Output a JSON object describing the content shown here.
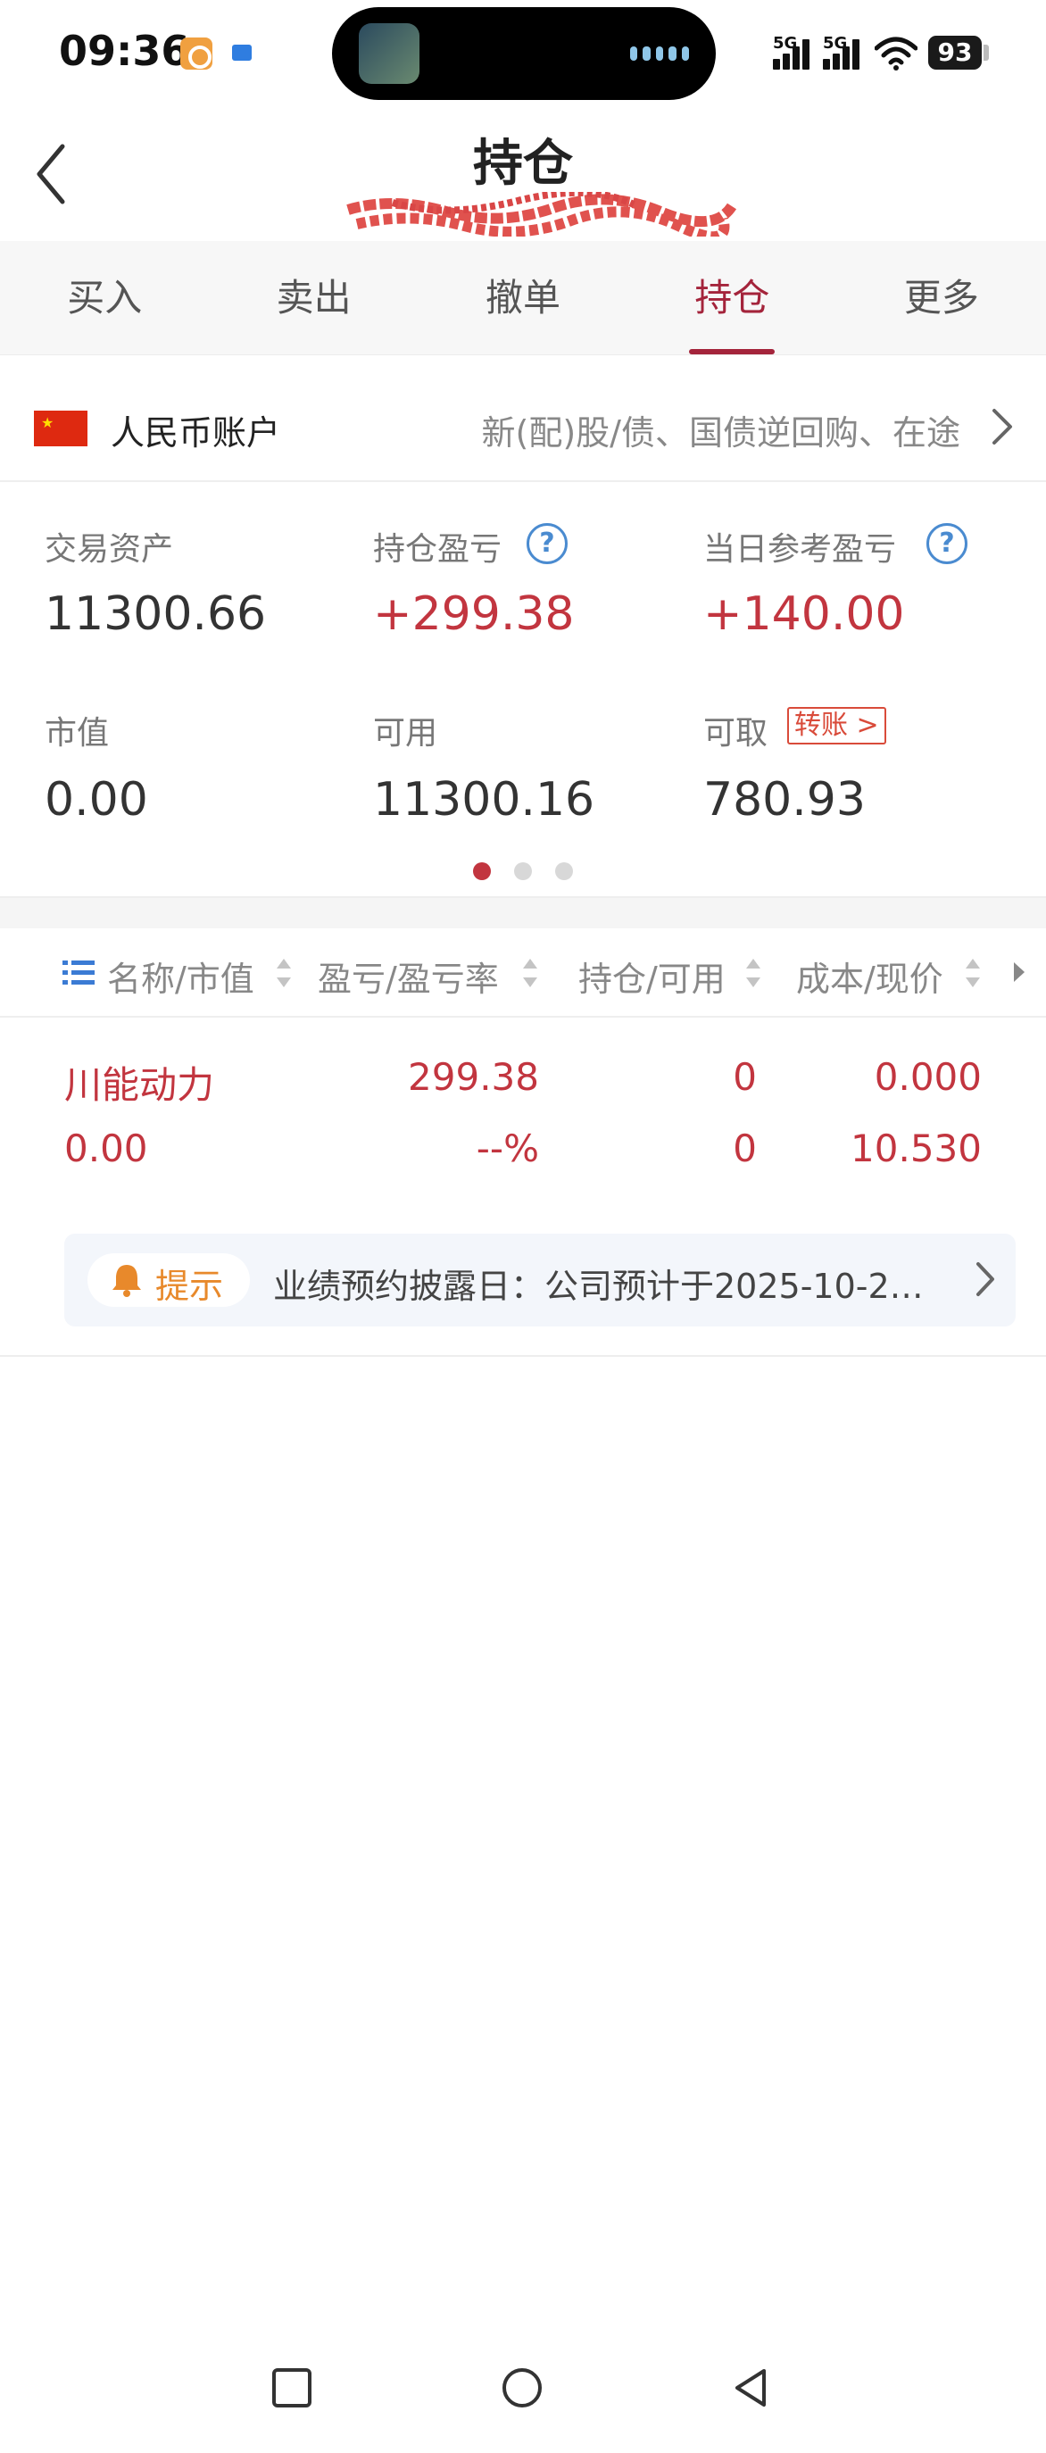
{
  "status_bar": {
    "time": "09:36",
    "network_1": "5G",
    "network_2": "5G",
    "battery": "93"
  },
  "header": {
    "title": "持仓"
  },
  "tabs": [
    {
      "label": "买入"
    },
    {
      "label": "卖出"
    },
    {
      "label": "撤单"
    },
    {
      "label": "持仓",
      "active": true
    },
    {
      "label": "更多"
    }
  ],
  "account": {
    "name": "人民币账户",
    "description": "新(配)股/债、国债逆回购、在途"
  },
  "stats": {
    "total_assets": {
      "label": "交易资产",
      "value": "11300.66"
    },
    "position_pnl": {
      "label": "持仓盈亏",
      "value": "+299.38"
    },
    "daily_pnl": {
      "label": "当日参考盈亏",
      "value": "+140.00"
    },
    "market_value": {
      "label": "市值",
      "value": "0.00"
    },
    "available": {
      "label": "可用",
      "value": "11300.16"
    },
    "withdrawable": {
      "label": "可取",
      "value": "780.93",
      "link": "转账 >"
    }
  },
  "pager": {
    "count": 3,
    "active": 0
  },
  "table": {
    "headers": [
      "名称/市值",
      "盈亏/盈亏率",
      "持仓/可用",
      "成本/现价"
    ],
    "rows": [
      {
        "name": "川能动力",
        "market_value": "0.00",
        "pnl": "299.38",
        "pnl_rate": "--%",
        "position": "0",
        "available": "0",
        "cost": "0.000",
        "price": "10.530"
      }
    ]
  },
  "notice": {
    "tag": "提示",
    "text": "业绩预约披露日：公司预计于2025-10-2…"
  },
  "colors": {
    "accent": "#a4243b",
    "gain": "#c2353f",
    "link": "#4a8bd0",
    "warning": "#e8892b"
  },
  "icons": [
    "back-chevron-icon",
    "china-flag-icon",
    "help-icon",
    "list-icon",
    "sort-icon",
    "bell-icon",
    "chevron-right-icon",
    "nav-square-icon",
    "nav-circle-icon",
    "nav-back-icon"
  ]
}
